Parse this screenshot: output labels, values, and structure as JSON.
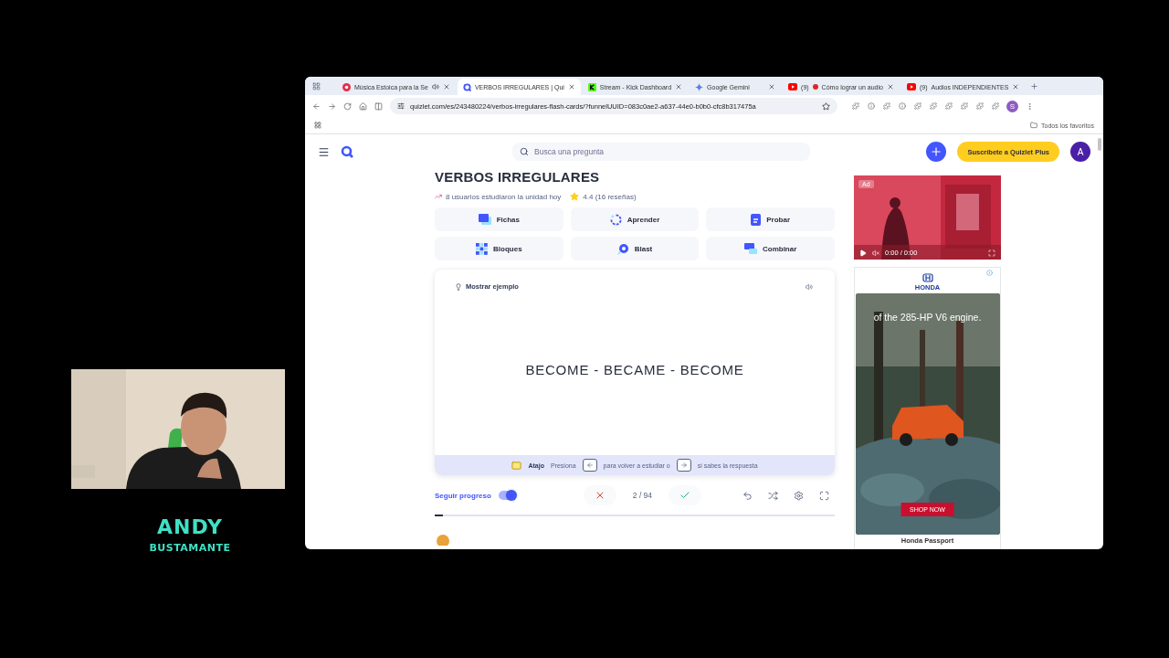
{
  "overlay": {
    "name_first": "ANDY",
    "name_last": "BUSTAMANTE"
  },
  "browser": {
    "tabs": [
      {
        "title": "Música Estoica para la Se",
        "kind": "music",
        "audio": true,
        "selected": false
      },
      {
        "title": "VERBOS IRREGULARES | Qui",
        "kind": "quizlet",
        "audio": false,
        "selected": true
      },
      {
        "title": "Stream - Kick Dashboard",
        "kind": "kick",
        "audio": false,
        "selected": false
      },
      {
        "title": "Google Gemini",
        "kind": "gemini",
        "audio": false,
        "selected": false
      },
      {
        "title": "Cómo lograr un audio",
        "prefix": "(9)",
        "live": true,
        "kind": "youtube",
        "audio": false,
        "selected": false
      },
      {
        "title": "Audios INDEPENDIENTES",
        "prefix": "(9)",
        "live": false,
        "kind": "youtube",
        "audio": false,
        "selected": false
      }
    ],
    "url": "quizlet.com/es/243480224/verbos-irregulares-flash-cards/?funnelUUID=083c0ae2-a637-44e0-b0b0-cfc8b317475a",
    "profile": "S",
    "bookmarks_folder": "Todos los favoritos"
  },
  "header": {
    "search_placeholder": "Busca una pregunta",
    "subscribe": "Suscríbete a Quizlet Plus",
    "avatar": "A"
  },
  "set": {
    "title": "VERBOS IRREGULARES",
    "studied": "8 usuarios estudiaron la unidad hoy",
    "rating": "4.4 (16 reseñas)"
  },
  "modes": [
    {
      "label": "Fichas",
      "kind": "cards"
    },
    {
      "label": "Aprender",
      "kind": "learn"
    },
    {
      "label": "Probar",
      "kind": "test"
    },
    {
      "label": "Bloques",
      "kind": "blocks"
    },
    {
      "label": "Blast",
      "kind": "blast"
    },
    {
      "label": "Combinar",
      "kind": "match"
    }
  ],
  "card": {
    "hint": "Mostrar ejemplo",
    "term": "BECOME - BECAME - BECOME"
  },
  "shortcut": {
    "label": "Atajo",
    "before": "Presiona",
    "middle": "para volver a estudiar o",
    "after": "si sabes la respuesta"
  },
  "controls": {
    "track_progress_label": "Seguir progreso",
    "track_progress_on": true,
    "counter": "2 / 94"
  },
  "progress": {
    "level": 0.02
  },
  "ads": {
    "video": {
      "badge": "Ad",
      "time": "0:00 / 0:00"
    },
    "display": {
      "brand": "HONDA",
      "headline": "of the 285-HP V6 engine.",
      "cta": "SHOP NOW",
      "caption": "Honda Passport"
    }
  }
}
